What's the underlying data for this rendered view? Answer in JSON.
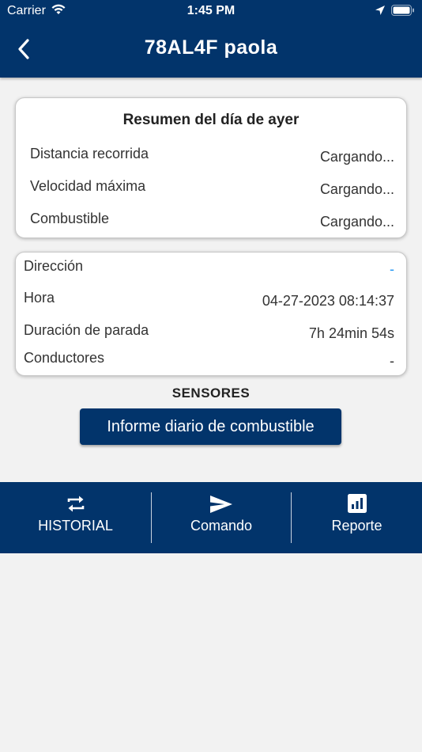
{
  "status_bar": {
    "carrier": "Carrier",
    "time": "1:45 PM"
  },
  "header": {
    "title": "78AL4F paola"
  },
  "summary": {
    "title": "Resumen del día de ayer",
    "rows": [
      {
        "label": "Distancia recorrida",
        "value": "Cargando..."
      },
      {
        "label": "Velocidad máxima",
        "value": "Cargando..."
      },
      {
        "label": "Combustible",
        "value": "Cargando..."
      }
    ]
  },
  "details": {
    "rows": [
      {
        "label": "Dirección",
        "value": "-"
      },
      {
        "label": "Hora",
        "value": "04-27-2023 08:14:37"
      },
      {
        "label": "Duración de parada",
        "value": "7h 24min 54s"
      },
      {
        "label": "Conductores",
        "value": "-"
      }
    ]
  },
  "sensors": {
    "heading": "SENSORES",
    "button_label": "Informe diario de combustible"
  },
  "tabbar": {
    "tabs": [
      {
        "label": "HISTORIAL",
        "icon": "repeat-icon"
      },
      {
        "label": "Comando",
        "icon": "send-icon"
      },
      {
        "label": "Reporte",
        "icon": "bar-chart-icon"
      }
    ]
  },
  "colors": {
    "brand": "#02346b",
    "accent": "#2196f3",
    "background": "#f2f2f2"
  }
}
